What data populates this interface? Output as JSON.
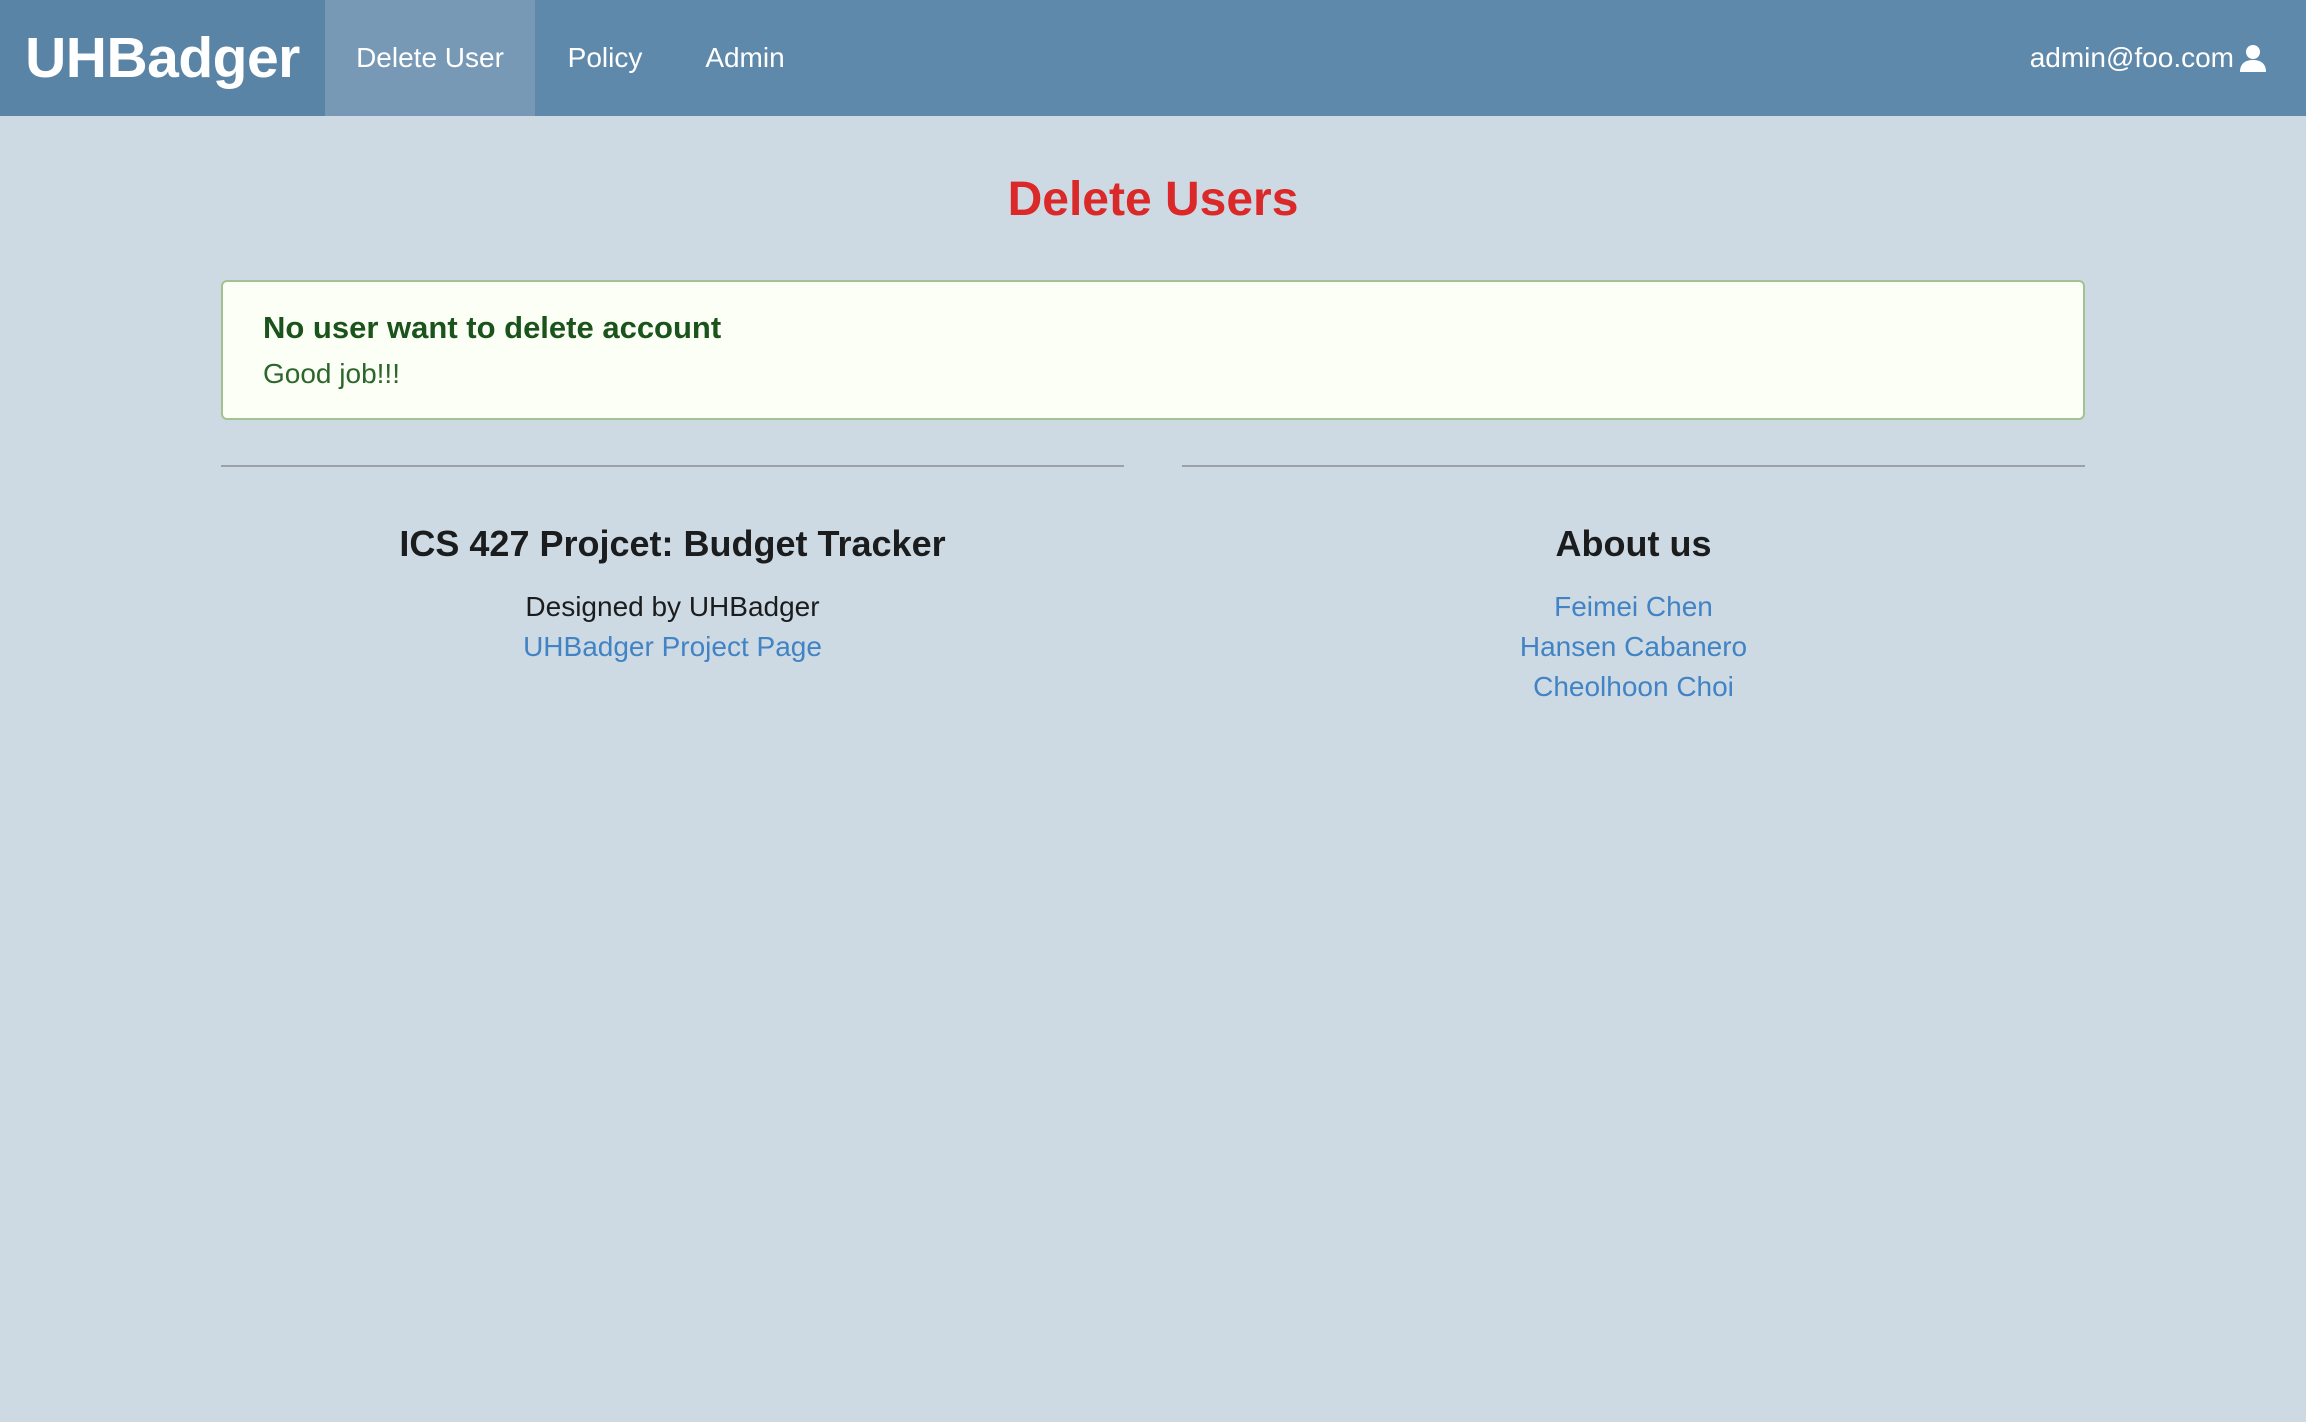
{
  "navbar": {
    "brand": "UHBadger",
    "items": [
      {
        "label": "Delete User",
        "active": true
      },
      {
        "label": "Policy",
        "active": false
      },
      {
        "label": "Admin",
        "active": false
      }
    ],
    "user": {
      "email": "admin@foo.com",
      "icon": "user-icon"
    }
  },
  "page": {
    "title": "Delete Users"
  },
  "message": {
    "header": "No user want to delete account",
    "body": "Good job!!!"
  },
  "footer": {
    "left": {
      "heading": "ICS 427 Projcet: Budget Tracker",
      "text": "Designed by UHBadger",
      "link": "UHBadger Project Page"
    },
    "right": {
      "heading": "About us",
      "links": [
        "Feimei Chen",
        "Hansen Cabanero",
        "Cheolhoon Choi"
      ]
    }
  },
  "colors": {
    "navbar": "#5f89ab",
    "active_item": "#7799b6",
    "background": "#cddae3",
    "title": "#db2828",
    "link": "#4183c4",
    "message_bg": "#fcfff5",
    "message_border": "#a3c293"
  }
}
